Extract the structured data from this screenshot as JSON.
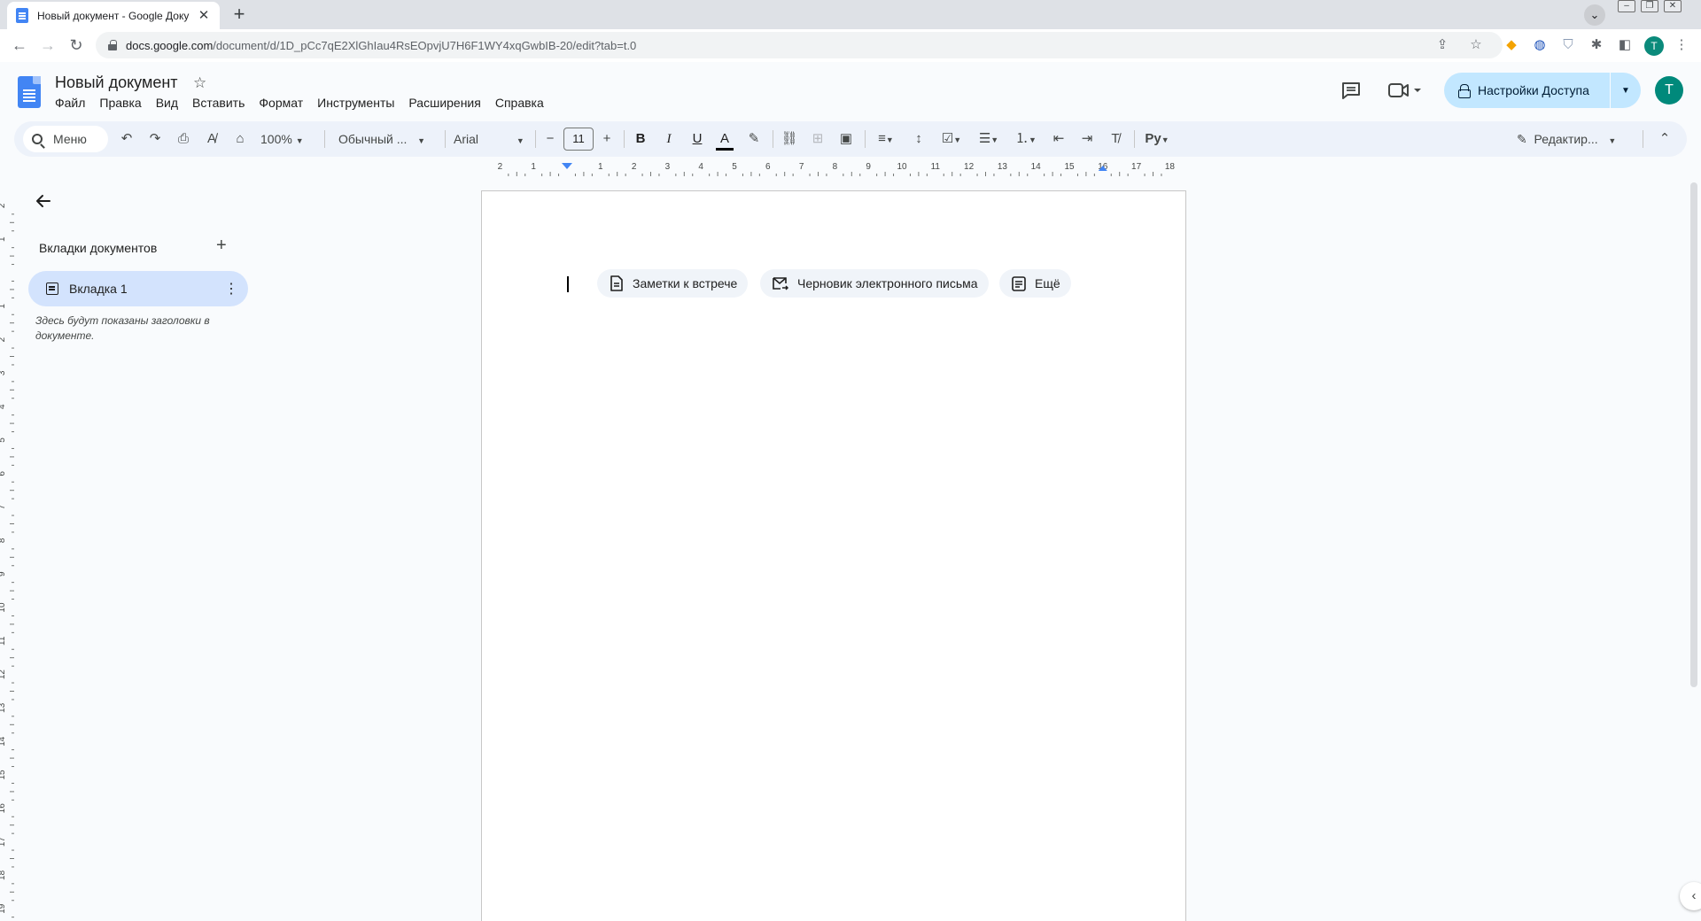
{
  "browser": {
    "tab_title": "Новый документ - Google Доку",
    "url_host": "docs.google.com",
    "url_path": "/document/d/1D_pCc7qE2XlGhIau4RsEOpvjU7H6F1WY4xqGwbIB-20/edit?tab=t.0",
    "profile_initial": "T"
  },
  "docs": {
    "title": "Новый документ",
    "menu": [
      "Файл",
      "Правка",
      "Вид",
      "Вставить",
      "Формат",
      "Инструменты",
      "Расширения",
      "Справка"
    ],
    "share_label": "Настройки Доступа",
    "user_initial": "T"
  },
  "toolbar": {
    "menu_search": "Меню",
    "zoom": "100%",
    "style": "Обычный ...",
    "font": "Arial",
    "font_size": "11",
    "edit_mode": "Редактир..."
  },
  "ruler": {
    "h_labels": [
      "2",
      "1",
      "1",
      "2",
      "3",
      "4",
      "5",
      "6",
      "7",
      "8",
      "9",
      "10",
      "11",
      "12",
      "13",
      "14",
      "15",
      "16",
      "17",
      "18"
    ],
    "v_labels": [
      "2",
      "1",
      "1",
      "2",
      "3",
      "4",
      "5",
      "6",
      "7",
      "8",
      "9",
      "10",
      "11",
      "12",
      "13",
      "14",
      "15",
      "16",
      "17",
      "18",
      "19"
    ]
  },
  "sidebar": {
    "heading": "Вкладки документов",
    "tab1_label": "Вкладка 1",
    "hint": "Здесь будут показаны заголовки в документе."
  },
  "chips": {
    "meeting_notes": "Заметки к встрече",
    "email_draft": "Черновик электронного письма",
    "more": "Ещё"
  },
  "colors": {
    "accent": "#0b57d0",
    "share_bg": "#c2e7ff",
    "tab_selected_bg": "#d3e3fd",
    "avatar": "#00897b"
  }
}
